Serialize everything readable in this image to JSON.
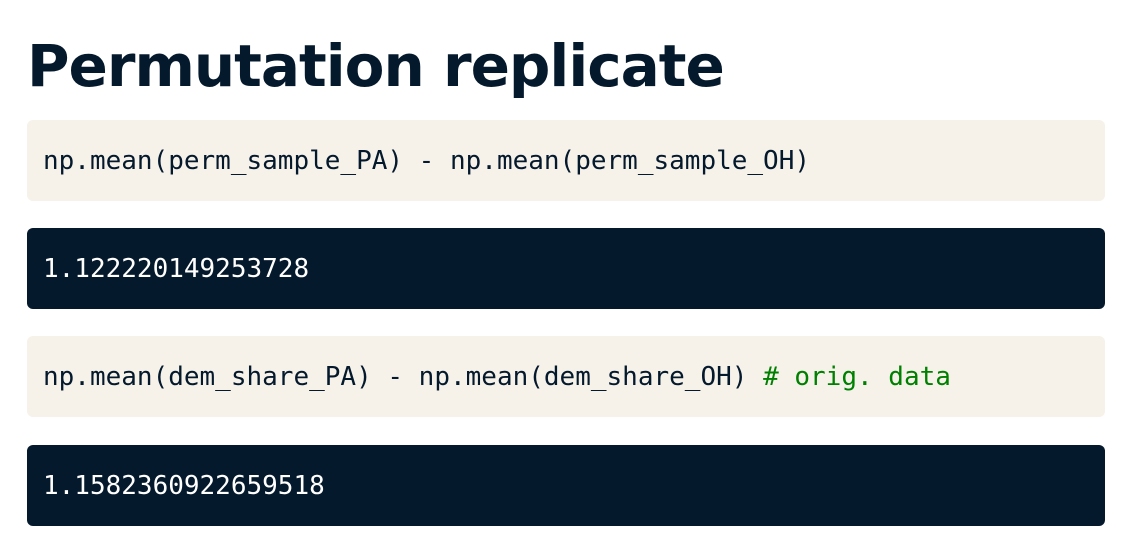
{
  "title": "Permutation replicate",
  "blocks": [
    {
      "code": "np.mean(perm_sample_PA) - np.mean(perm_sample_OH)",
      "comment": ""
    },
    {
      "output": "1.122220149253728"
    },
    {
      "code": "np.mean(dem_share_PA) - np.mean(dem_share_OH) ",
      "comment": "# orig. data"
    },
    {
      "output": "1.1582360922659518"
    }
  ],
  "colors": {
    "title": "#05192d",
    "code_bg": "#f6f2ea",
    "output_bg": "#05192d",
    "output_text": "#ffffff",
    "comment": "#008000"
  }
}
